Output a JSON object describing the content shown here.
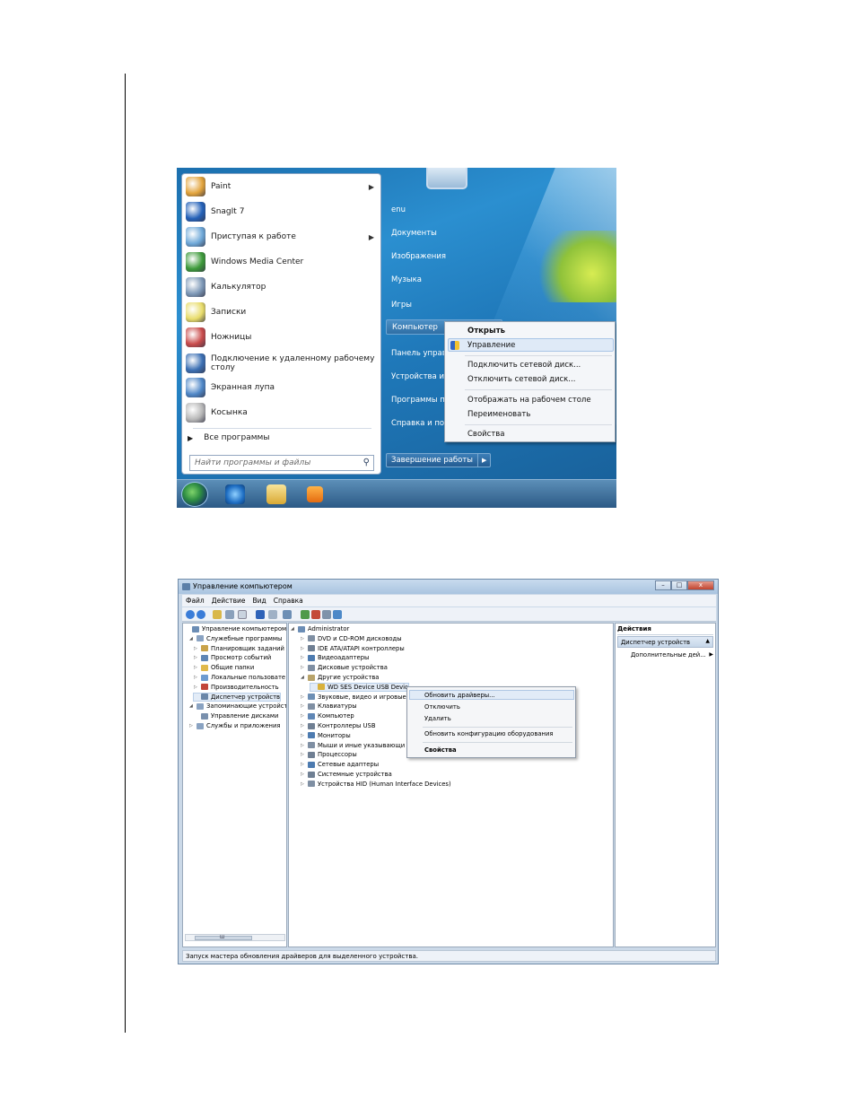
{
  "start_menu": {
    "programs": [
      {
        "label": "Paint",
        "icon": "paint-icon",
        "color": "#e2a33b",
        "has_arrow": true
      },
      {
        "label": "SnagIt 7",
        "icon": "snagit-icon",
        "color": "#2461b8",
        "has_arrow": false
      },
      {
        "label": "Приступая к работе",
        "icon": "getting-started-icon",
        "color": "#6ea8d8",
        "has_arrow": true
      },
      {
        "label": "Windows Media Center",
        "icon": "media-center-icon",
        "color": "#3d9a3a",
        "has_arrow": false
      },
      {
        "label": "Калькулятор",
        "icon": "calculator-icon",
        "color": "#7d98b7",
        "has_arrow": false
      },
      {
        "label": "Записки",
        "icon": "sticky-notes-icon",
        "color": "#e8dc6a",
        "has_arrow": false
      },
      {
        "label": "Ножницы",
        "icon": "scissors-icon",
        "color": "#c94b4b",
        "has_arrow": false
      },
      {
        "label": "Подключение к удаленному рабочему",
        "label2": "столу",
        "icon": "remote-desktop-icon",
        "color": "#3b6fb3",
        "has_arrow": false
      },
      {
        "label": "Экранная лупа",
        "icon": "magnifier-icon",
        "color": "#4f87c7",
        "has_arrow": false
      },
      {
        "label": "Косынка",
        "icon": "solitaire-icon",
        "color": "#b7b7b7",
        "has_arrow": false
      }
    ],
    "all_programs": "Все программы",
    "search_placeholder": "Найти программы и файлы",
    "right_items": [
      "enu",
      "Документы",
      "Изображения",
      "Музыка",
      "Игры",
      "Компьютер",
      "Панель управ",
      "Устройства и п",
      "Программы п",
      "Справка и под"
    ],
    "shutdown_label": "Завершение работы",
    "context_menu": {
      "open": "Открыть",
      "manage": "Управление",
      "map_drive": "Подключить сетевой диск...",
      "disconnect_drive": "Отключить сетевой диск...",
      "show_desktop": "Отображать на рабочем столе",
      "rename": "Переименовать",
      "properties": "Свойства"
    }
  },
  "comp_mgmt": {
    "title": "Управление компьютером",
    "menu": [
      "Файл",
      "Действие",
      "Вид",
      "Справка"
    ],
    "left_tree": [
      {
        "label": "Управление компьютером (л",
        "level": 0,
        "expand": "",
        "color": "#6b8db5"
      },
      {
        "label": "Служебные программы",
        "level": 1,
        "expand": "◢",
        "color": "#8aa3c2"
      },
      {
        "label": "Планировщик заданий",
        "level": 2,
        "expand": "▷",
        "color": "#c9a34a"
      },
      {
        "label": "Просмотр событий",
        "level": 2,
        "expand": "▷",
        "color": "#5f86b5"
      },
      {
        "label": "Общие папки",
        "level": 2,
        "expand": "▷",
        "color": "#e0b94c"
      },
      {
        "label": "Локальные пользовате",
        "level": 2,
        "expand": "▷",
        "color": "#6d9bd0"
      },
      {
        "label": "Производительность",
        "level": 2,
        "expand": "▷",
        "color": "#c2453a"
      },
      {
        "label": "Диспетчер устройств",
        "level": 2,
        "expand": "",
        "color": "#6a86a8",
        "selected": true
      },
      {
        "label": "Запоминающие устройст",
        "level": 1,
        "expand": "◢",
        "color": "#8aa3c2"
      },
      {
        "label": "Управление дисками",
        "level": 2,
        "expand": "",
        "color": "#7990ad"
      },
      {
        "label": "Службы и приложения",
        "level": 1,
        "expand": "▷",
        "color": "#8aa3c2"
      }
    ],
    "device_tree": [
      {
        "label": "Administrator",
        "level": 0,
        "expand": "◢",
        "color": "#6b8db5"
      },
      {
        "label": "DVD и CD-ROM дисководы",
        "level": 1,
        "expand": "▷",
        "color": "#7f8fa3"
      },
      {
        "label": "IDE ATA/ATAPI контроллеры",
        "level": 1,
        "expand": "▷",
        "color": "#6f7f93"
      },
      {
        "label": "Видеоадаптеры",
        "level": 1,
        "expand": "▷",
        "color": "#4d7bb0"
      },
      {
        "label": "Дисковые устройства",
        "level": 1,
        "expand": "▷",
        "color": "#7f8fa3"
      },
      {
        "label": "Другие устройства",
        "level": 1,
        "expand": "◢",
        "color": "#b8a36a"
      },
      {
        "label": "WD SES Device USB Devic",
        "level": 2,
        "expand": "",
        "color": "#d9b13b",
        "selected": true
      },
      {
        "label": "Звуковые, видео и игровые",
        "level": 1,
        "expand": "▷",
        "color": "#6d8fb5"
      },
      {
        "label": "Клавиатуры",
        "level": 1,
        "expand": "▷",
        "color": "#7f8fa3"
      },
      {
        "label": "Компьютер",
        "level": 1,
        "expand": "▷",
        "color": "#5f86b5"
      },
      {
        "label": "Контроллеры USB",
        "level": 1,
        "expand": "▷",
        "color": "#6f7f93"
      },
      {
        "label": "Мониторы",
        "level": 1,
        "expand": "▷",
        "color": "#4d7bb0"
      },
      {
        "label": "Мыши и иные указывающи",
        "level": 1,
        "expand": "▷",
        "color": "#7f8fa3"
      },
      {
        "label": "Процессоры",
        "level": 1,
        "expand": "▷",
        "color": "#6f7f93"
      },
      {
        "label": "Сетевые адаптеры",
        "level": 1,
        "expand": "▷",
        "color": "#4d7bb0"
      },
      {
        "label": "Системные устройства",
        "level": 1,
        "expand": "▷",
        "color": "#6f7f93"
      },
      {
        "label": "Устройства HID (Human Interface Devices)",
        "level": 1,
        "expand": "▷",
        "color": "#7f8fa3"
      }
    ],
    "context_menu": {
      "update": "Обновить драйверы...",
      "disable": "Отключить",
      "remove": "Удалить",
      "scan": "Обновить конфигурацию оборудования",
      "properties": "Свойства"
    },
    "actions": {
      "header": "Действия",
      "section": "Диспетчер устройств",
      "more": "Дополнительные дей..."
    },
    "scrollbar_label": "Ш",
    "status": "Запуск мастера обновления драйверов для выделенного устройства."
  }
}
